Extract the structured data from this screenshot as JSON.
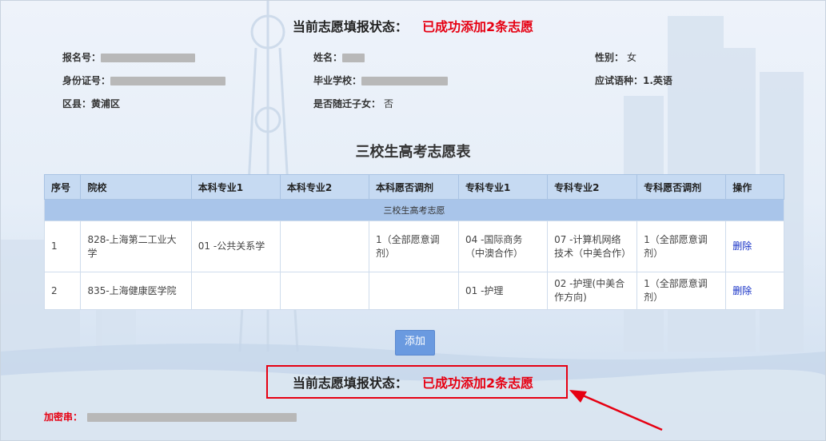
{
  "status": {
    "label": "当前志愿填报状态：",
    "value": "已成功添加2条志愿"
  },
  "info": {
    "reg_no_label": "报名号：",
    "name_label": "姓名：",
    "gender_label": "性别：",
    "gender_value": "女",
    "id_label": "身份证号：",
    "school_label": "毕业学校：",
    "language_label": "应试语种：",
    "language_value": "1.英语",
    "district_label": "区县：",
    "district_value": "黄浦区",
    "migrant_label": "是否随迁子女：",
    "migrant_value": "否"
  },
  "table": {
    "title": "三校生高考志愿表",
    "headers": [
      "序号",
      "院校",
      "本科专业1",
      "本科专业2",
      "本科愿否调剂",
      "专科专业1",
      "专科专业2",
      "专科愿否调剂",
      "操作"
    ],
    "group_label": "三校生高考志愿",
    "rows": [
      {
        "no": "1",
        "school": "828-上海第二工业大学",
        "ug1": "01 -公共关系学",
        "ug2": "",
        "ug_adjust": "1（全部愿意调剂）",
        "jc1": "04 -国际商务（中澳合作）",
        "jc2": "07 -计算机网络技术（中美合作）",
        "jc_adjust": "1（全部愿意调剂）",
        "action": "删除"
      },
      {
        "no": "2",
        "school": "835-上海健康医学院",
        "ug1": "",
        "ug2": "",
        "ug_adjust": "",
        "jc1": "01 -护理",
        "jc2": "02 -护理(中美合作方向)",
        "jc_adjust": "1（全部愿意调剂）",
        "action": "删除"
      }
    ]
  },
  "add_button": "添加",
  "cipher_label": "加密串：",
  "colors": {
    "accent_red": "#e60012",
    "header_blue": "#c6daf2",
    "button_blue": "#6a9ae0",
    "link_blue": "#1530c6"
  }
}
